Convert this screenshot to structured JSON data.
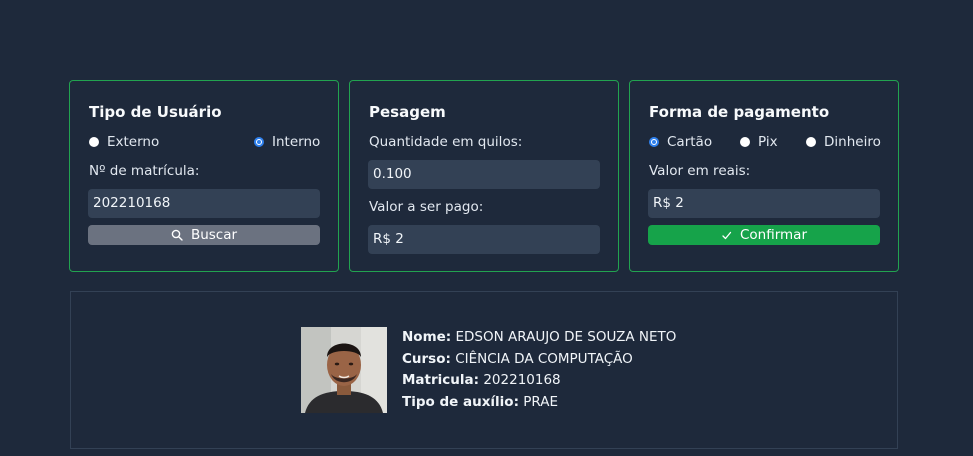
{
  "tipo_usuario": {
    "title": "Tipo de Usuário",
    "options": [
      "Externo",
      "Interno"
    ],
    "selected": "Interno",
    "matricula_label": "Nº de matrícula:",
    "matricula_value": "202210168",
    "buscar_label": "Buscar"
  },
  "pesagem": {
    "title": "Pesagem",
    "quantidade_label": "Quantidade em quilos:",
    "quantidade_value": "0.100",
    "valor_label": "Valor a ser pago:",
    "valor_value": "R$ 2"
  },
  "pagamento": {
    "title": "Forma de pagamento",
    "options": [
      "Cartão",
      "Pix",
      "Dinheiro"
    ],
    "selected": "Cartão",
    "valor_label": "Valor em reais:",
    "valor_value": "R$ 2",
    "confirmar_label": "Confirmar"
  },
  "aluno": {
    "nome_label": "Nome:",
    "nome_value": "EDSON ARAUJO DE SOUZA NETO",
    "curso_label": "Curso:",
    "curso_value": "CIÊNCIA DA COMPUTAÇÃO",
    "matricula_label": "Matricula:",
    "matricula_value": "202210168",
    "auxilio_label": "Tipo de auxílio:",
    "auxilio_value": "PRAE"
  },
  "colors": {
    "background": "#1e293b",
    "card_border": "#22a350",
    "field": "#334155",
    "button_gray": "#6b7280",
    "button_green": "#16a34a",
    "radio_accent": "#2f80ed"
  }
}
